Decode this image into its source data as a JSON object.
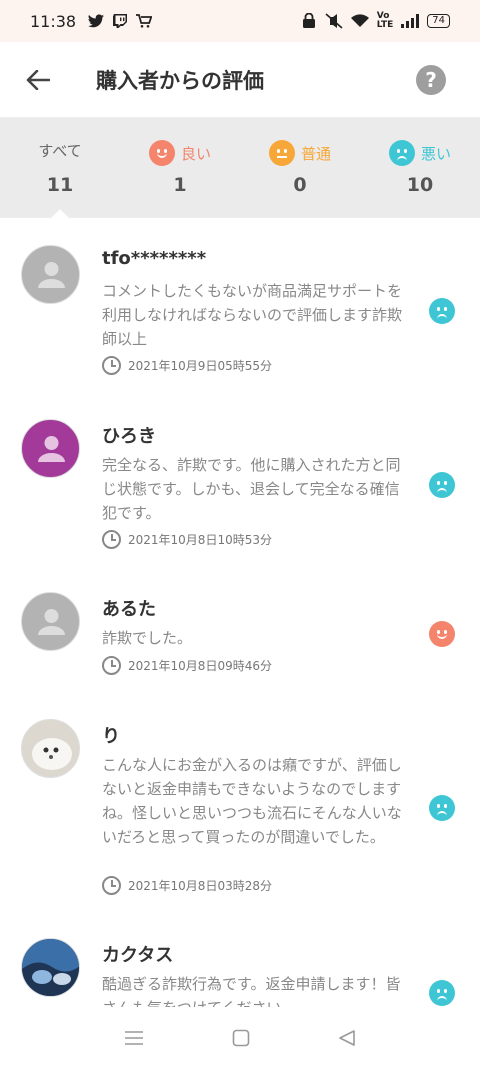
{
  "status": {
    "time": "11:38",
    "battery": "74"
  },
  "header": {
    "title": "購入者からの評価"
  },
  "summary": {
    "all": {
      "label": "すべて",
      "count": "11"
    },
    "good": {
      "label": "良い",
      "count": "1"
    },
    "normal": {
      "label": "普通",
      "count": "0"
    },
    "bad": {
      "label": "悪い",
      "count": "10"
    }
  },
  "colors": {
    "good": "#f4846c",
    "normal": "#f7a737",
    "bad": "#3fc6d4"
  },
  "reviews": [
    {
      "name": "tfo********",
      "text": "コメントしたくもないが商品満足サポートを利用しなければならないので評価します詐欺師以上",
      "date": "2021年10月9日05時55分",
      "rating": "bad",
      "avatar": "default-gray"
    },
    {
      "name": "ひろき",
      "text": "完全なる、詐欺です。他に購入された方と同じ状態です。しかも、退会して完全なる確信犯です。",
      "date": "2021年10月8日10時53分",
      "rating": "bad",
      "avatar": "default-purple"
    },
    {
      "name": "あるた",
      "text": "詐欺でした。",
      "date": "2021年10月8日09時46分",
      "rating": "good",
      "avatar": "default-gray"
    },
    {
      "name": "り",
      "text": "こんな人にお金が入るのは癪ですが、評価しないと返金申請もできないようなのでしますね。怪しいと思いつつも流石にそんな人いないだろと思って買ったのが間違いでした。",
      "date": "2021年10月8日03時28分",
      "rating": "bad",
      "avatar": "photo-dog"
    },
    {
      "name": "カクタス",
      "text": "酷過ぎる詐欺行為です。返金申請します！皆さんも気をつけてください。",
      "date": "",
      "rating": "bad",
      "avatar": "photo-art"
    }
  ]
}
